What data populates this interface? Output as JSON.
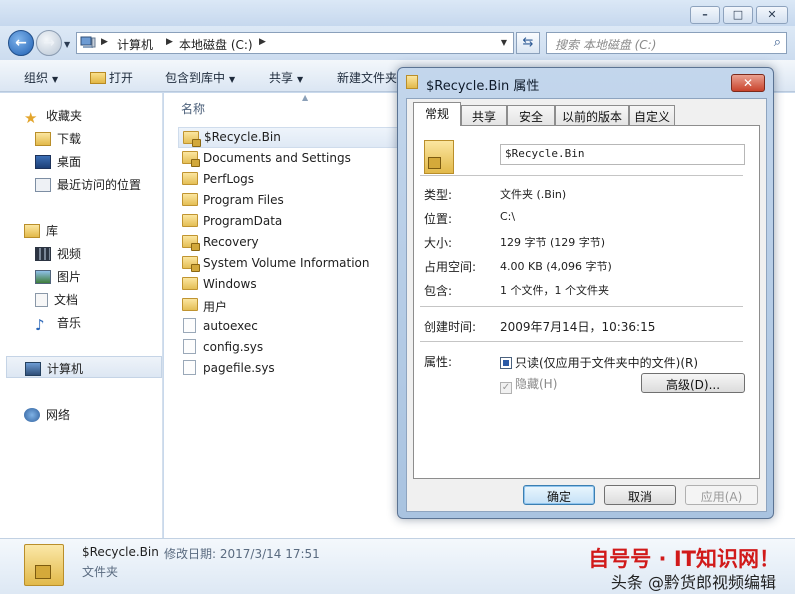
{
  "window": {
    "address": {
      "crumbs": [
        "计算机",
        "本地磁盘 (C:)"
      ]
    },
    "search_placeholder": "搜索 本地磁盘 (C:)",
    "toolbar": [
      "组织",
      "打开",
      "包含到库中",
      "共享",
      "新建文件夹"
    ]
  },
  "navpane": {
    "favorites": {
      "label": "收藏夹",
      "items": [
        "下载",
        "桌面",
        "最近访问的位置"
      ]
    },
    "libraries": {
      "label": "库",
      "items": [
        "视频",
        "图片",
        "文档",
        "音乐"
      ]
    },
    "computer": "计算机",
    "network": "网络"
  },
  "filelist": {
    "column": "名称",
    "files": [
      {
        "name": "$Recycle.Bin",
        "kind": "locked-folder"
      },
      {
        "name": "Documents and Settings",
        "kind": "locked-folder"
      },
      {
        "name": "PerfLogs",
        "kind": "folder"
      },
      {
        "name": "Program Files",
        "kind": "folder"
      },
      {
        "name": "ProgramData",
        "kind": "folder"
      },
      {
        "name": "Recovery",
        "kind": "locked-folder"
      },
      {
        "name": "System Volume Information",
        "kind": "locked-folder"
      },
      {
        "name": "Windows",
        "kind": "folder"
      },
      {
        "name": "用户",
        "kind": "folder"
      },
      {
        "name": "autoexec",
        "kind": "file"
      },
      {
        "name": "config.sys",
        "kind": "file"
      },
      {
        "name": "pagefile.sys",
        "kind": "file"
      }
    ]
  },
  "details": {
    "name": "$Recycle.Bin",
    "modified_label": "修改日期: 2017/3/14 17:51",
    "type": "文件夹"
  },
  "watermark": {
    "brand": "自号号 · IT知识网！",
    "credit": "头条 @黔货郎视频编辑"
  },
  "dialog": {
    "title": "$Recycle.Bin 属性",
    "tabs": [
      "常规",
      "共享",
      "安全",
      "以前的版本",
      "自定义"
    ],
    "name": "$Recycle.Bin",
    "rows": [
      {
        "label": "类型:",
        "value": "文件夹 (.Bin)"
      },
      {
        "label": "位置:",
        "value": "C:\\"
      },
      {
        "label": "大小:",
        "value": "129 字节 (129 字节)"
      },
      {
        "label": "占用空间:",
        "value": "4.00 KB (4,096 字节)"
      },
      {
        "label": "包含:",
        "value": "1 个文件，1 个文件夹"
      }
    ],
    "created": {
      "label": "创建时间:",
      "value": "2009年7月14日，10:36:15"
    },
    "attributes": {
      "label": "属性:",
      "readonly": "只读(仅应用于文件夹中的文件)(R)",
      "hidden": "隐藏(H)",
      "advanced": "高级(D)..."
    },
    "buttons": {
      "ok": "确定",
      "cancel": "取消",
      "apply": "应用(A)"
    }
  }
}
